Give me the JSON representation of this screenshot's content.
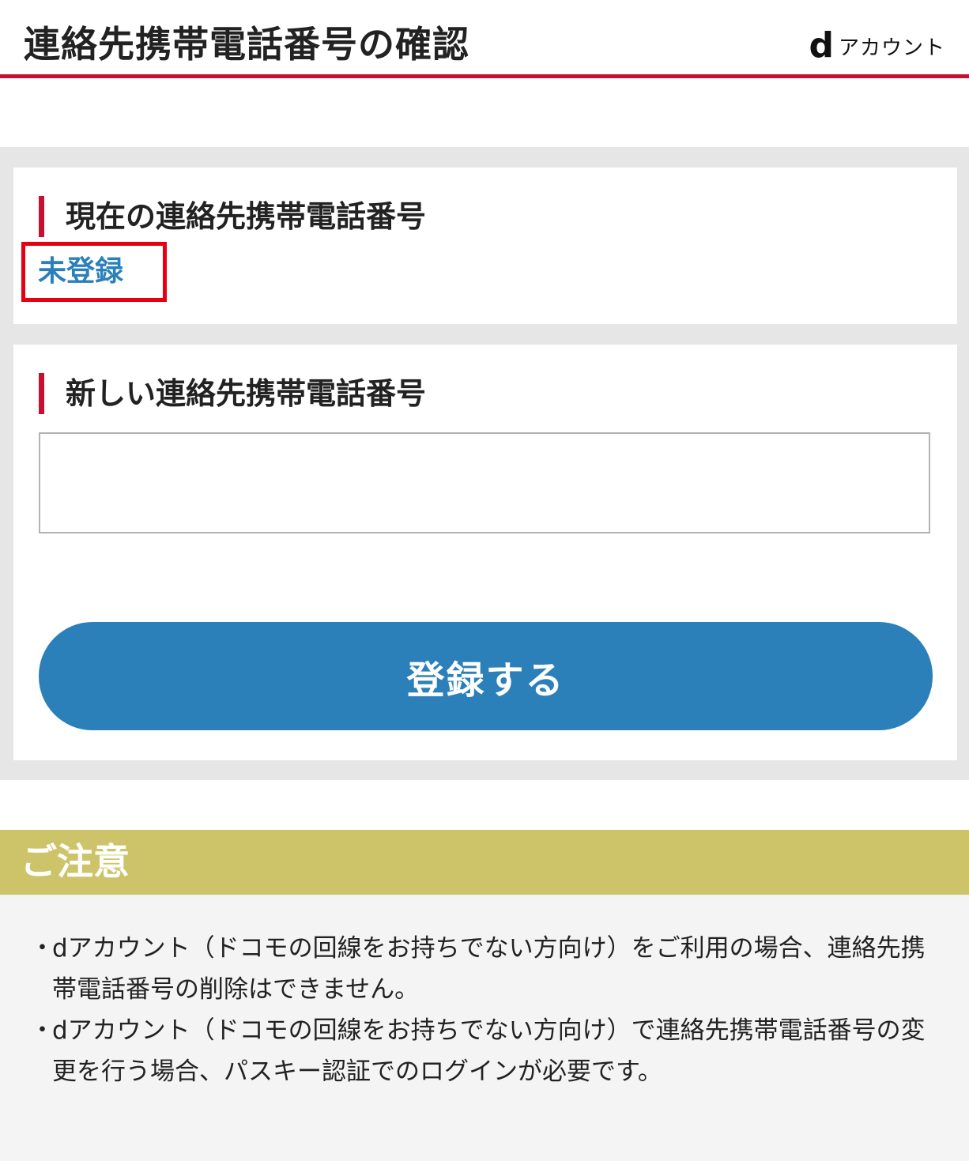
{
  "header": {
    "title": "連絡先携帯電話番号の確認",
    "brand_d": "d",
    "brand_text": "アカウント"
  },
  "current": {
    "heading": "現在の連絡先携帯電話番号",
    "value": "未登録"
  },
  "new_number": {
    "heading": "新しい連絡先携帯電話番号",
    "input_value": "",
    "placeholder": ""
  },
  "actions": {
    "register_label": "登録する"
  },
  "notice": {
    "title": "ご注意",
    "bullet": "・",
    "items": [
      "dアカウント（ドコモの回線をお持ちでない方向け）をご利用の場合、連絡先携帯電話番号の削除はできません。",
      "dアカウント（ドコモの回線をお持ちでない方向け）で連絡先携帯電話番号の変更を行う場合、パスキー認証でのログインが必要です。"
    ]
  },
  "colors": {
    "accent_red": "#c8102e",
    "highlight_red": "#e60012",
    "primary_blue": "#2b80b9",
    "notice_olive": "#cdc46a",
    "panel_gray": "#e6e6e6"
  }
}
